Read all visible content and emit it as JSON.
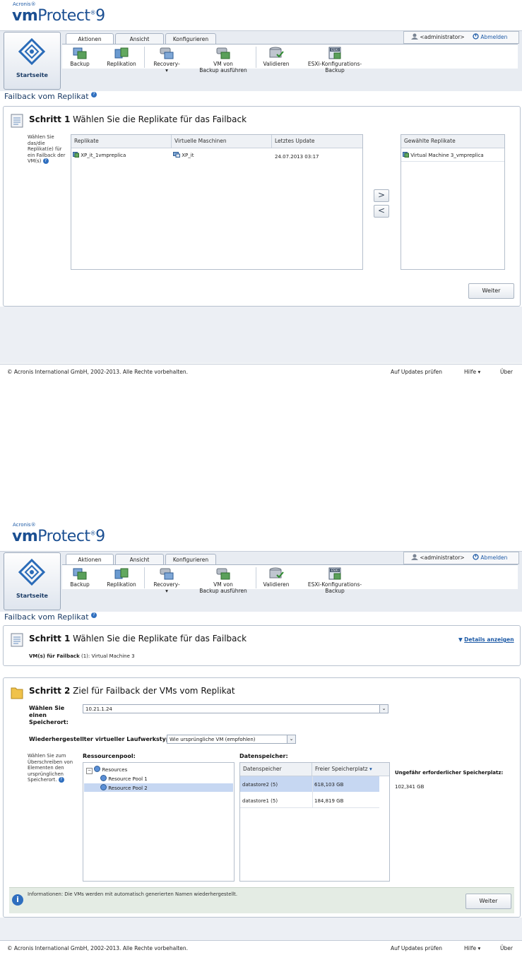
{
  "app": {
    "vendor": "Acronis",
    "product_bold": "vm",
    "product_rest": "Protect",
    "version": "9",
    "registered": "®"
  },
  "tabs": [
    "Aktionen",
    "Ansicht",
    "Konfigurieren"
  ],
  "toolbar": {
    "home": "Startseite",
    "backup": "Backup",
    "replication": "Replikation",
    "recovery": "Recovery-",
    "recovery_arrow": "▾",
    "run_vm_1": "VM von",
    "run_vm_2": "Backup ausführen",
    "validate": "Validieren",
    "esxi_1": "ESXi-Konfigurations-",
    "esxi_2": "Backup",
    "esxi_badge": "ESXi"
  },
  "user": {
    "name": "<administrator>",
    "logout": "Abmelden"
  },
  "page_title": "Failback vom Replikat",
  "help_glyph": "?",
  "screen1": {
    "step_label": "Schritt 1",
    "step_title": "Wählen Sie die Replikate für das Failback",
    "help_text_lines": [
      "Wählen Sie",
      "das/die",
      "Replikat(e) für",
      "ein Failback der",
      "VM(s)"
    ],
    "columns": [
      "Replikate",
      "Virtuelle Maschinen",
      "Letztes Update"
    ],
    "rows": [
      {
        "replica": "XP_it_1vmpreplica",
        "vm": "XP_it",
        "updated": "24.07.2013 03:17"
      }
    ],
    "selected_header": "Gewählte Replikate",
    "selected_items": [
      "Virtual Machine 3_vmpreplica"
    ],
    "move_right": ">",
    "move_left": "<",
    "next_button": "Weiter"
  },
  "screen2": {
    "step1_label": "Schritt 1",
    "step1_title": "Wählen Sie die Replikate für das Failback",
    "details_link": "Details anzeigen",
    "details_arrow": "▼",
    "vm_summary_label": "VM(s) für Failback",
    "vm_summary_count": "(1):",
    "vm_summary_value": "Virtual Machine 3",
    "step2_label": "Schritt 2",
    "step2_title": "Ziel für Failback der VMs vom Replikat",
    "location_label": "Wählen Sie einen Speicherort:",
    "location_value": "10.21.1.24",
    "disk_type_label": "Wiederhergestellter virtueller Laufwerkstyp:",
    "disk_type_value": "Wie ursprüngliche VM (empfohlen)",
    "overwrite_help_lines": [
      "Wählen Sie zum",
      "Überschreiben von",
      "Elementen den",
      "ursprünglichen",
      "Speicherort."
    ],
    "resource_pool_label": "Ressourcenpool:",
    "pool_tree": {
      "root": "Resources",
      "children": [
        "Resource Pool 1",
        "Resource Pool 2"
      ]
    },
    "datastore_label": "Datenspeicher:",
    "ds_columns": [
      "Datenspeicher",
      "Freier Speicherplatz"
    ],
    "ds_sort_glyph": "▾",
    "ds_rows": [
      {
        "name": "datastore2 (5)",
        "free": "618,103 GB"
      },
      {
        "name": "datastore1 (5)",
        "free": "184,819 GB"
      }
    ],
    "required_space_label": "Ungefähr erforderlicher Speicherplatz:",
    "required_space_value": "102,341 GB",
    "info_text": "Informationen: Die VMs werden mit automatisch generierten Namen wiederhergestellt.",
    "info_glyph": "i",
    "next_button": "Weiter"
  },
  "footer": {
    "copyright": "© Acronis International GmbH, 2002-2013. Alle Rechte vorbehalten.",
    "updates": "Auf Updates prüfen",
    "help": "Hilfe ▾",
    "about": "Über"
  }
}
